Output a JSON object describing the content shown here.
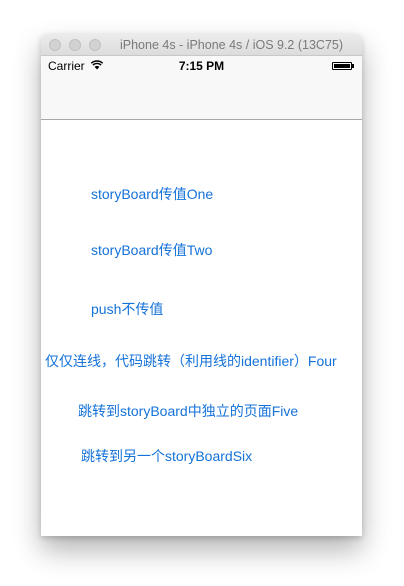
{
  "window": {
    "title": "iPhone 4s - iPhone 4s / iOS 9.2 (13C75)"
  },
  "statusbar": {
    "carrier": "Carrier",
    "time": "7:15 PM",
    "wifi_icon": "wifi-icon",
    "battery_icon": "battery-icon",
    "battery_level": 1.0
  },
  "buttons": [
    {
      "label": "storyBoard传值One"
    },
    {
      "label": "storyBoard传值Two"
    },
    {
      "label": "push不传值"
    },
    {
      "label": "仅仅连线，代码跳转（利用线的identifier）Four"
    },
    {
      "label": "跳转到storyBoard中独立的页面Five"
    },
    {
      "label": "跳转到另一个storyBoardSix"
    }
  ],
  "colors": {
    "link": "#1472d9",
    "bar_background": "#f8f8f8"
  }
}
